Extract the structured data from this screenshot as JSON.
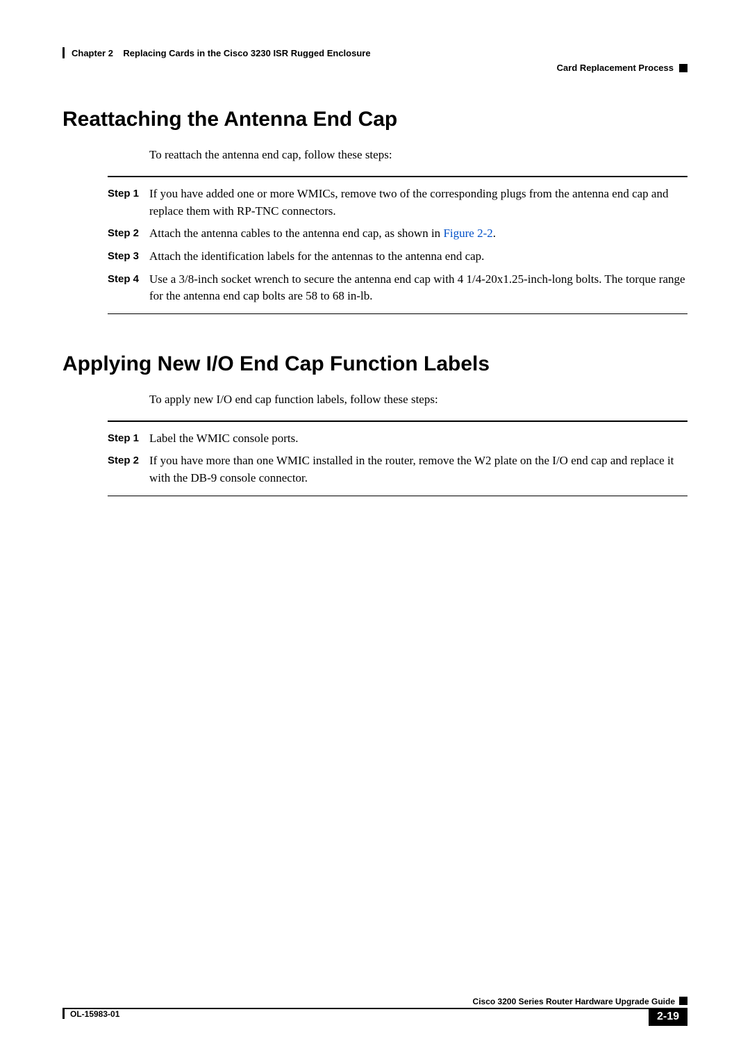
{
  "header": {
    "chapter": "Chapter 2",
    "chapter_title": "Replacing Cards in the Cisco 3230 ISR Rugged Enclosure",
    "section_right": "Card Replacement Process"
  },
  "section1": {
    "title": "Reattaching the Antenna End Cap",
    "intro": "To reattach the antenna end cap, follow these steps:",
    "steps": [
      {
        "label": "Step 1",
        "text": "If you have added one or more WMICs, remove two of the corresponding plugs from the antenna end cap and replace them with RP-TNC connectors."
      },
      {
        "label": "Step 2",
        "text_pre": "Attach the antenna cables to the antenna end cap, as shown in ",
        "link": "Figure 2-2",
        "text_post": "."
      },
      {
        "label": "Step 3",
        "text": "Attach the identification labels for the antennas to the antenna end cap."
      },
      {
        "label": "Step 4",
        "text": "Use a 3/8-inch socket wrench to secure the antenna end cap with 4 1/4-20x1.25-inch-long bolts. The torque range for the antenna end cap bolts are 58 to 68 in-lb."
      }
    ]
  },
  "section2": {
    "title": "Applying New I/O End Cap Function Labels",
    "intro": "To apply new I/O end cap function labels, follow these steps:",
    "steps": [
      {
        "label": "Step 1",
        "text": "Label the WMIC console ports."
      },
      {
        "label": "Step 2",
        "text": "If you have more than one WMIC installed in the router, remove the W2 plate on the I/O end cap and replace it with the DB-9 console connector."
      }
    ]
  },
  "footer": {
    "guide": "Cisco 3200 Series Router Hardware Upgrade Guide",
    "doc_id": "OL-15983-01",
    "page": "2-19"
  }
}
